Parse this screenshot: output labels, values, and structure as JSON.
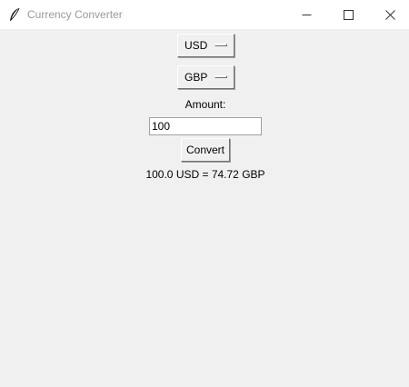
{
  "window": {
    "title": "Currency Converter",
    "background": "#f0f0f0",
    "titlebar_icons": [
      "feather-icon",
      "minimize-icon",
      "maximize-icon",
      "close-icon"
    ]
  },
  "form": {
    "from_currency": "USD",
    "to_currency": "GBP",
    "amount_label": "Amount:",
    "amount_value": "100",
    "convert_label": "Convert",
    "result_text": "100.0 USD = 74.72 GBP"
  }
}
